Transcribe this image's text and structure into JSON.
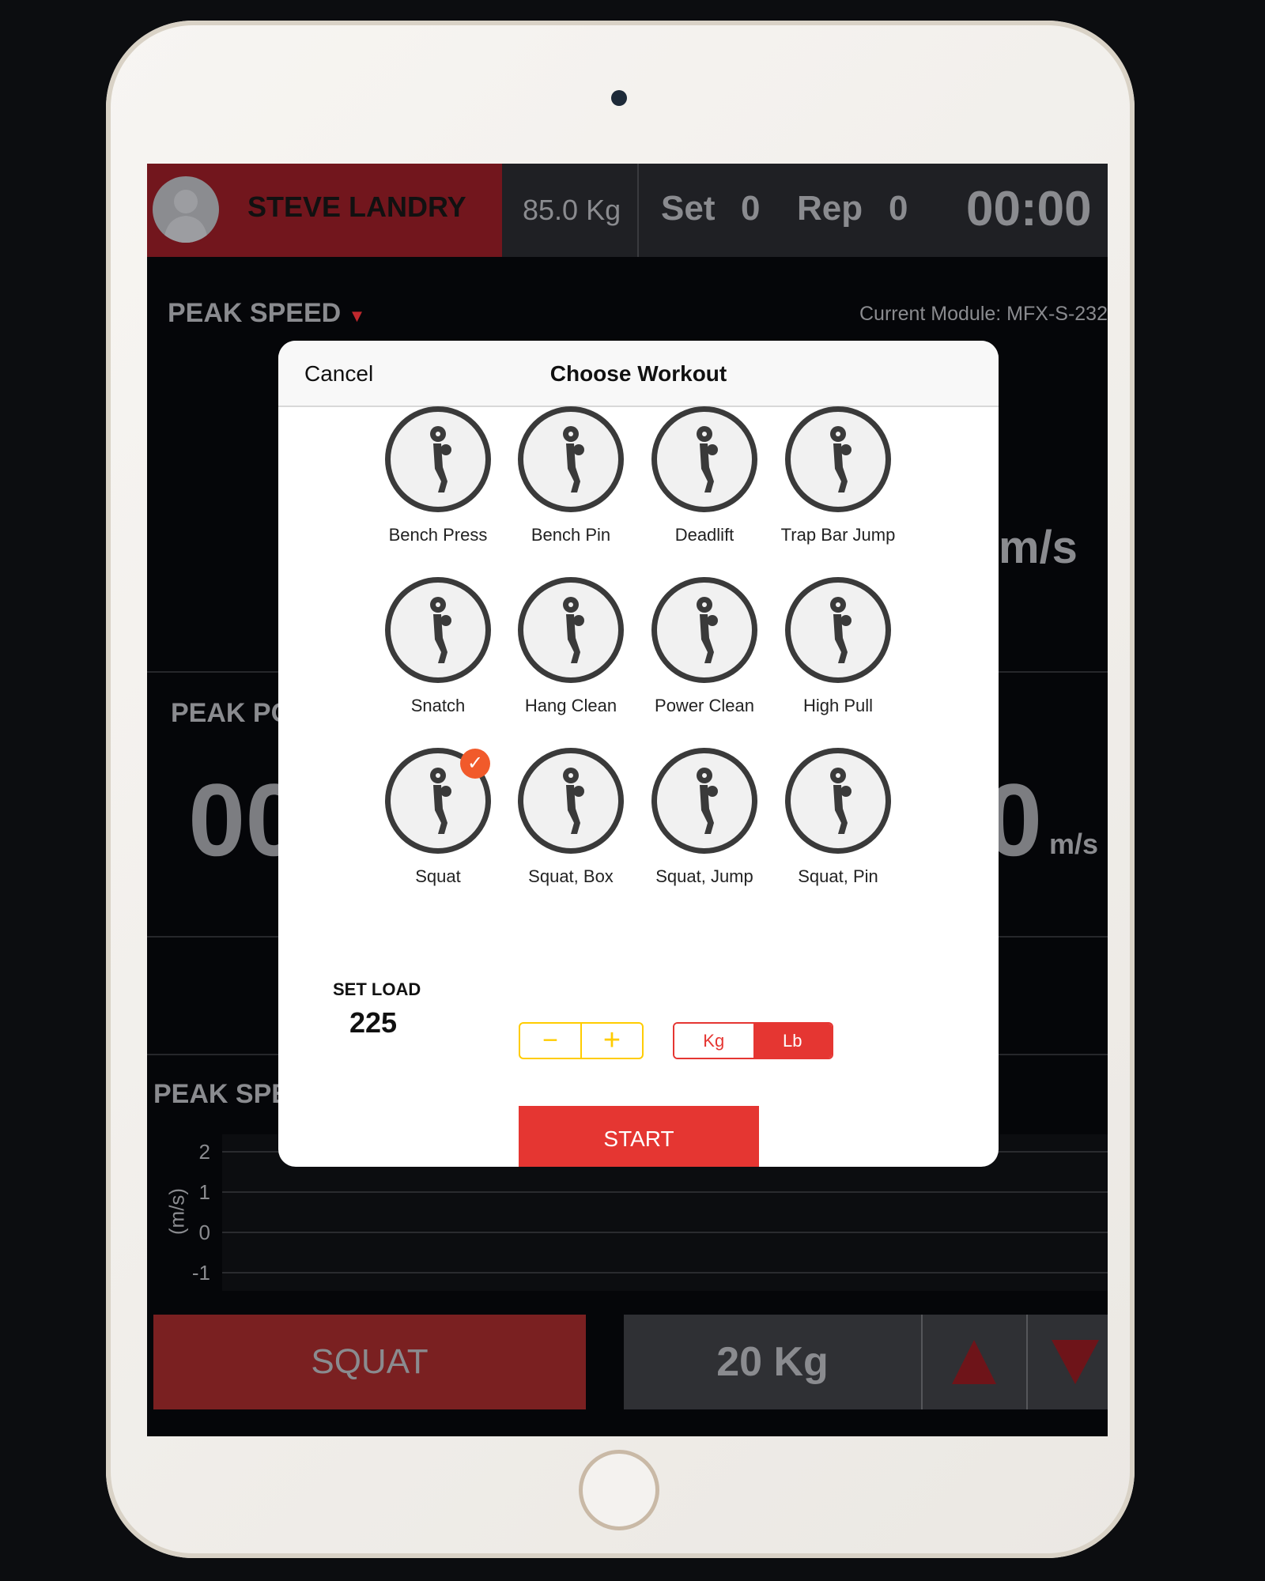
{
  "header": {
    "user_name": "STEVE LANDRY",
    "body_weight": "85.0 Kg",
    "set_label": "Set",
    "set_value": "0",
    "rep_label": "Rep",
    "rep_value": "0",
    "timer": "00:00"
  },
  "dashboard": {
    "metric_selector": "PEAK SPEED",
    "current_module": "Current Module: MFX-S-232",
    "speed_unit_top": "m/s",
    "peak_power_label": "PEAK PO",
    "peak_power_value": "00",
    "right_value": "0",
    "right_unit": "m/s",
    "chart_title": "PEAK SPE"
  },
  "chart_data": {
    "type": "line",
    "ylabel": "(m/s)",
    "yticks": [
      "2",
      "1",
      "0",
      "-1"
    ],
    "ylim": [
      -1,
      2
    ],
    "grid": true,
    "series": []
  },
  "bottom": {
    "exercise": "SQUAT",
    "load": "20 Kg"
  },
  "modal": {
    "cancel": "Cancel",
    "title": "Choose Workout",
    "workouts": [
      {
        "name": "Bench Press",
        "icon": "bench-press-icon",
        "selected": false
      },
      {
        "name": "Bench Pin",
        "icon": "bench-pin-icon",
        "selected": false
      },
      {
        "name": "Deadlift",
        "icon": "deadlift-icon",
        "selected": false
      },
      {
        "name": "Trap Bar Jump",
        "icon": "trap-bar-jump-icon",
        "selected": false
      },
      {
        "name": "Snatch",
        "icon": "snatch-icon",
        "selected": false
      },
      {
        "name": "Hang Clean",
        "icon": "hang-clean-icon",
        "selected": false
      },
      {
        "name": "Power Clean",
        "icon": "power-clean-icon",
        "selected": false
      },
      {
        "name": "High Pull",
        "icon": "high-pull-icon",
        "selected": false
      },
      {
        "name": "Squat",
        "icon": "squat-icon",
        "selected": true
      },
      {
        "name": "Squat, Box",
        "icon": "squat-box-icon",
        "selected": false
      },
      {
        "name": "Squat, Jump",
        "icon": "squat-jump-icon",
        "selected": false
      },
      {
        "name": "Squat, Pin",
        "icon": "squat-pin-icon",
        "selected": false
      }
    ],
    "set_load_label": "SET LOAD",
    "set_load_value": "225",
    "minus": "−",
    "plus": "+",
    "unit_kg": "Kg",
    "unit_lb": "Lb",
    "selected_unit": "Lb",
    "start": "START"
  },
  "colors": {
    "brand_red": "#72161d",
    "accent_red": "#e53632",
    "stepper_yellow": "#ffcc00",
    "check_orange": "#f15a2b"
  }
}
